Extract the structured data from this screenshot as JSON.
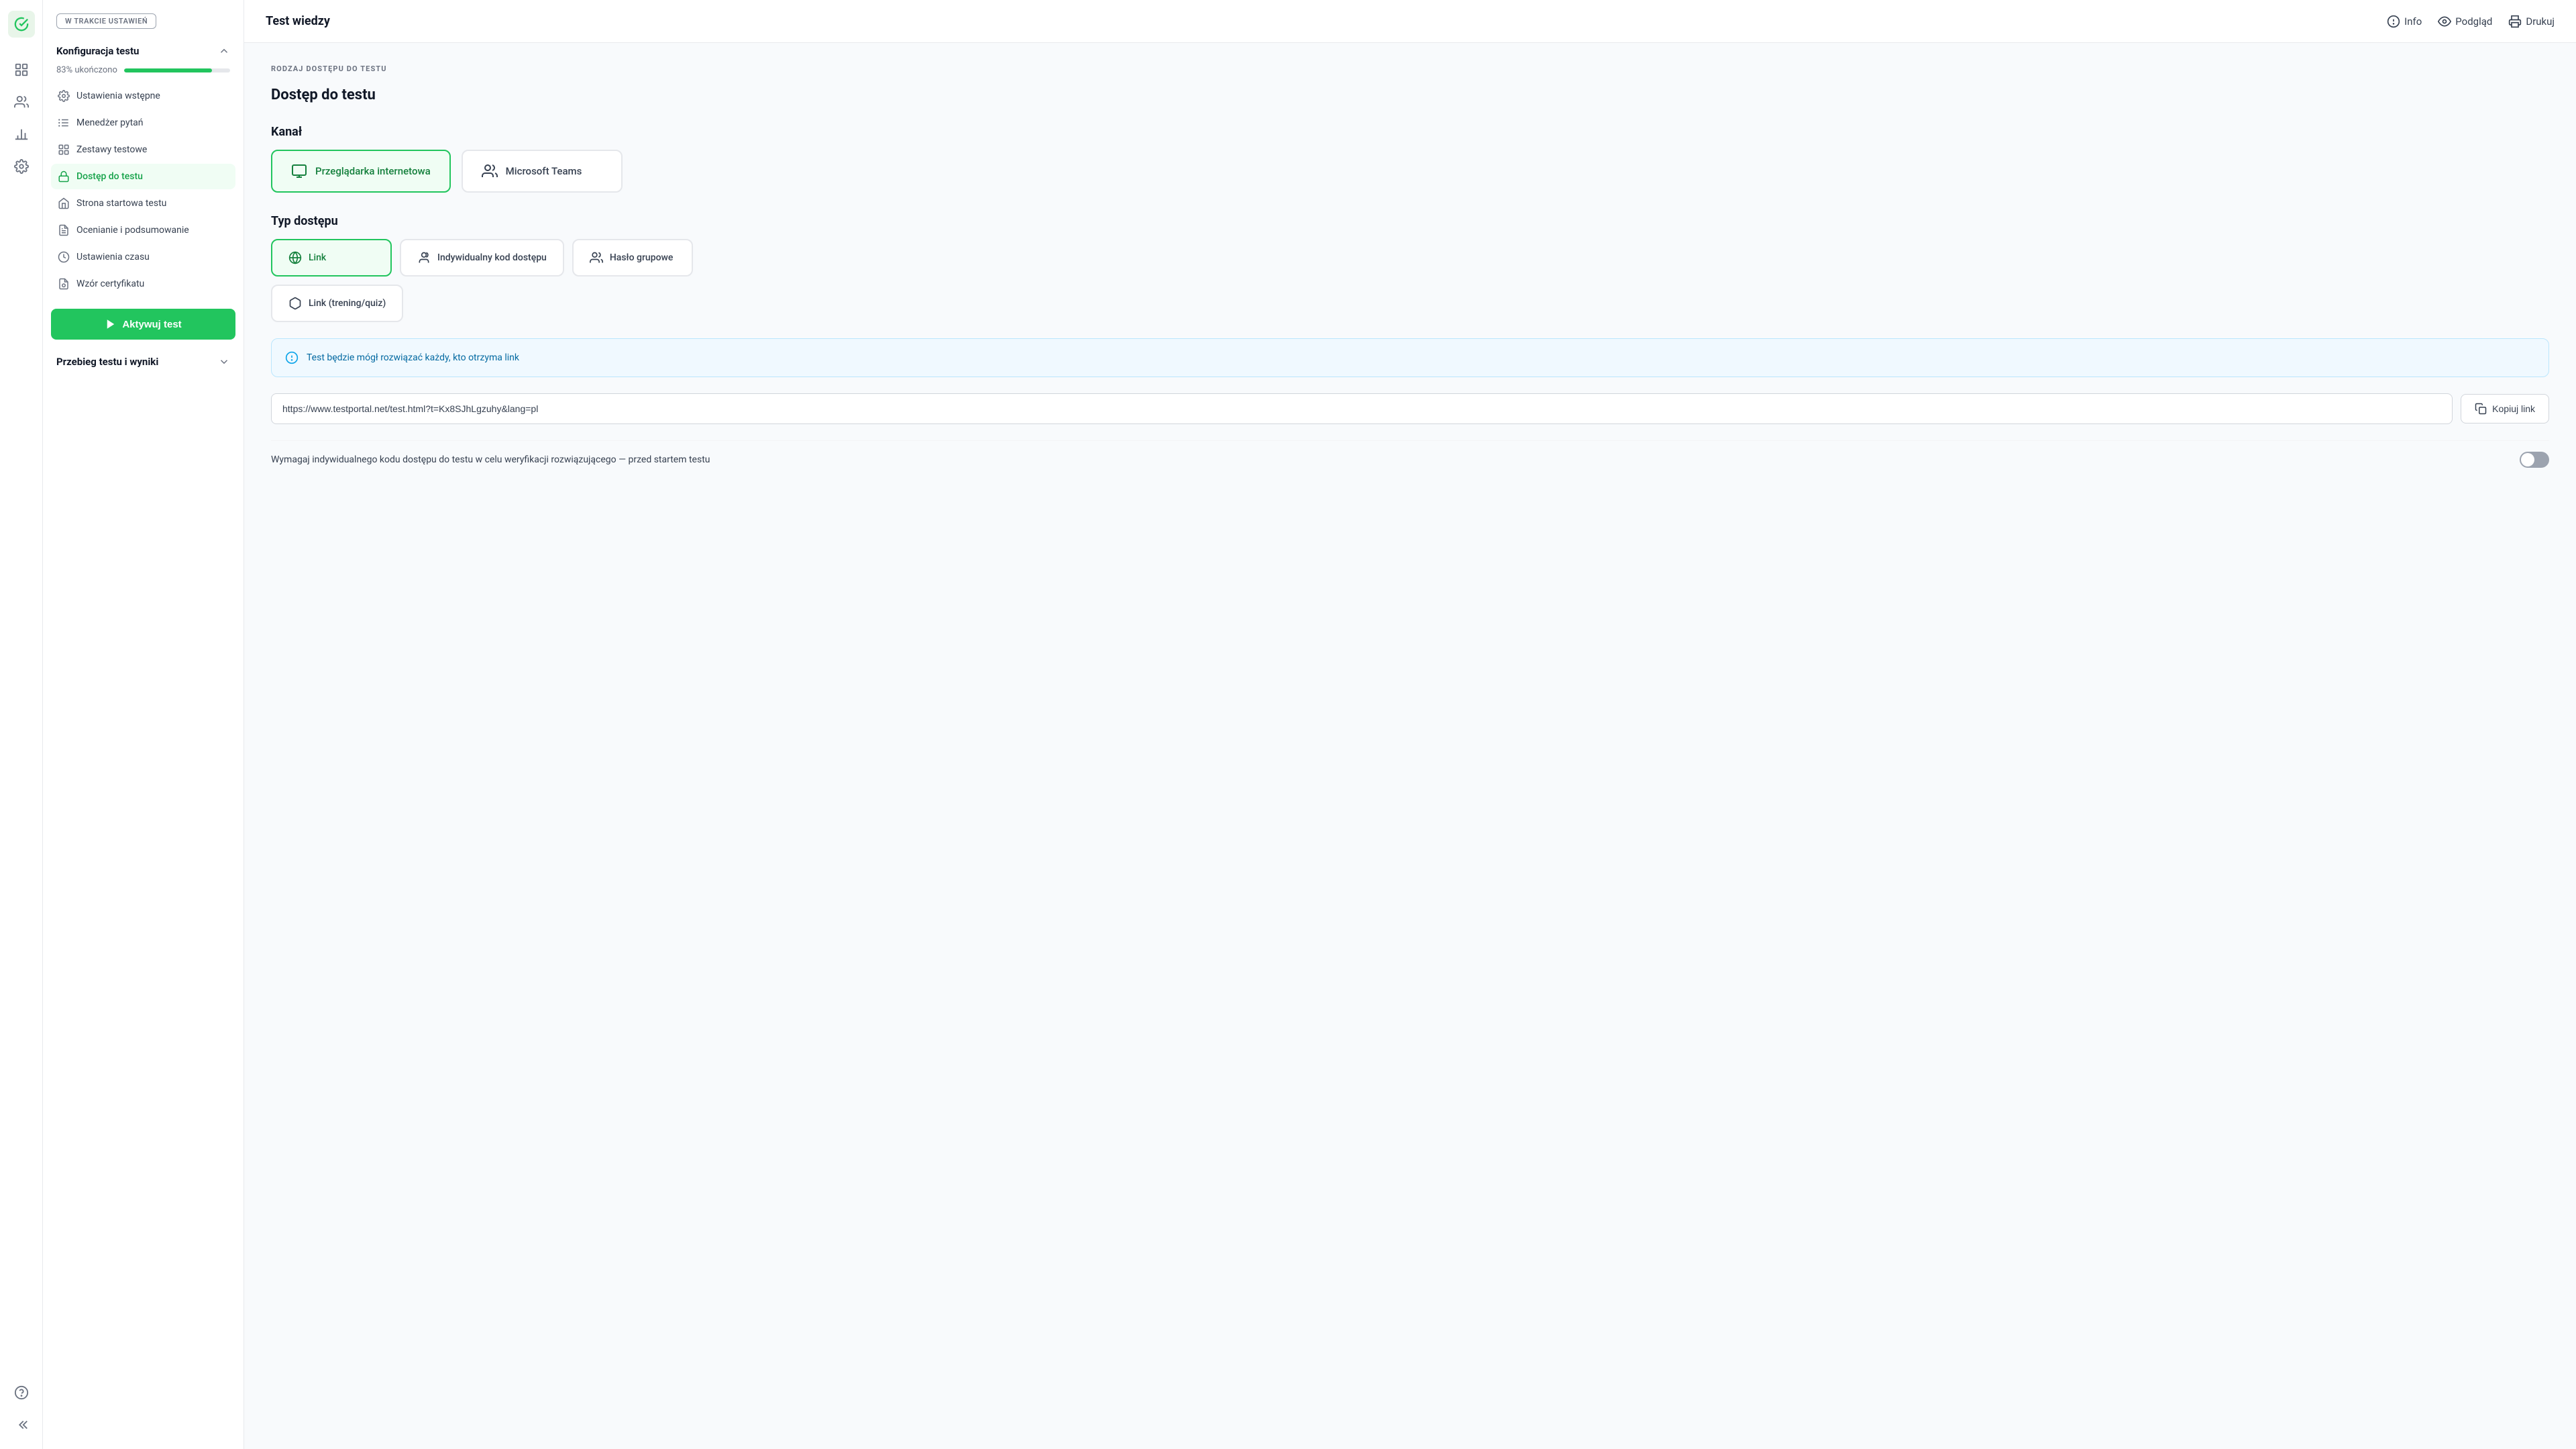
{
  "app": {
    "logo_icon": "check-circle-icon"
  },
  "topbar": {
    "title": "Test wiedzy",
    "info_label": "Info",
    "preview_label": "Podgląd",
    "print_label": "Drukuj"
  },
  "sidebar": {
    "status_badge": "W TRAKCIE USTAWIEŃ",
    "section1": {
      "title": "Konfiguracja testu",
      "progress_label": "83% ukończono",
      "progress_value": 83,
      "nav_items": [
        {
          "id": "ustawienia",
          "label": "Ustawienia wstępne",
          "icon": "settings-icon"
        },
        {
          "id": "menedzer",
          "label": "Menedżer pytań",
          "icon": "questions-icon"
        },
        {
          "id": "zestawy",
          "label": "Zestawy testowe",
          "icon": "sets-icon"
        },
        {
          "id": "dostep",
          "label": "Dostęp do testu",
          "icon": "access-icon",
          "active": true
        },
        {
          "id": "strona",
          "label": "Strona startowa testu",
          "icon": "start-icon"
        },
        {
          "id": "ocenianie",
          "label": "Ocenianie i podsumowanie",
          "icon": "grading-icon"
        },
        {
          "id": "czas",
          "label": "Ustawienia czasu",
          "icon": "time-icon"
        },
        {
          "id": "wzor",
          "label": "Wzór certyfikatu",
          "icon": "certificate-icon"
        }
      ]
    },
    "activate_btn": "Aktywuj test",
    "section2": {
      "title": "Przebieg testu i wyniki"
    }
  },
  "content": {
    "page_title": "Dostęp do testu",
    "section_label": "RODZAJ DOSTĘPU DO TESTU",
    "channel_section": {
      "title": "Kanał",
      "options": [
        {
          "id": "browser",
          "label": "Przeglądarka internetowa",
          "selected": true
        },
        {
          "id": "teams",
          "label": "Microsoft Teams",
          "selected": false
        }
      ]
    },
    "access_type_section": {
      "title": "Typ dostępu",
      "options": [
        {
          "id": "link",
          "label": "Link",
          "selected": true
        },
        {
          "id": "individual",
          "label": "Indywidualny kod dostępu",
          "selected": false
        },
        {
          "id": "password",
          "label": "Hasło grupowe",
          "selected": false
        },
        {
          "id": "training",
          "label": "Link (trening/quiz)",
          "selected": false
        }
      ]
    },
    "info_box": {
      "text": "Test będzie mógł rozwiązać każdy, kto otrzyma link"
    },
    "url_field": {
      "value": "https://www.testportal.net/test.html?t=Kx8SJhLgzuhy&lang=pl"
    },
    "copy_btn": "Kopiuj link",
    "toggle_row": {
      "text": "Wymagaj indywidualnego kodu dostępu do testu w celu weryfikacji rozwiązującego — przed startem testu",
      "enabled": false
    }
  },
  "rail_icons": [
    {
      "id": "logo",
      "icon": "check-icon"
    },
    {
      "id": "grid",
      "icon": "grid-icon"
    },
    {
      "id": "users",
      "icon": "users-icon"
    },
    {
      "id": "chart",
      "icon": "chart-icon"
    },
    {
      "id": "settings",
      "icon": "settings-gear-icon"
    },
    {
      "id": "help",
      "icon": "help-icon"
    },
    {
      "id": "back",
      "icon": "back-icon"
    }
  ]
}
